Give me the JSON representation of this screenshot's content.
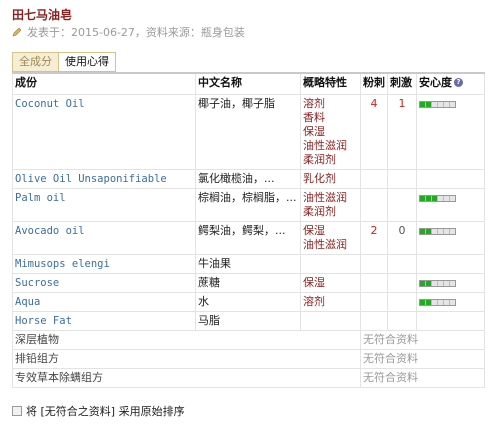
{
  "page": {
    "title": "田七马油皂",
    "meta": "发表于：2015-06-27，资料来源：瓶身包装"
  },
  "tabs": [
    {
      "label": "全成分"
    },
    {
      "label": "使用心得"
    }
  ],
  "table": {
    "headers": {
      "ingredient": "成份",
      "chinese": "中文名称",
      "function": "概略特性",
      "acne": "粉刺",
      "irritation": "刺激",
      "safety": "安心度"
    },
    "rows": [
      {
        "ingredient": "Coconut Oil",
        "chinese": "椰子油，椰子脂",
        "functions": [
          "溶剂",
          "香料",
          "保湿",
          "油性滋润",
          "柔润剂"
        ],
        "acne": "4",
        "irritation": "1",
        "safety": 2
      },
      {
        "ingredient": "Olive Oil Unsaponifiable",
        "chinese": "氯化橄榄油，...",
        "functions": [
          "乳化剂"
        ],
        "acne": "",
        "irritation": "",
        "safety": null
      },
      {
        "ingredient": "Palm oil",
        "chinese": "棕榈油，棕榈脂，...",
        "functions": [
          "油性滋润",
          "柔润剂"
        ],
        "acne": "",
        "irritation": "",
        "safety": 3
      },
      {
        "ingredient": "Avocado oil",
        "chinese": "鳄梨油，鳄梨，...",
        "functions": [
          "保湿",
          "油性滋润"
        ],
        "acne": "2",
        "irritation": "0",
        "safety": 2
      },
      {
        "ingredient": "Mimusops elengi",
        "chinese": "牛油果",
        "functions": [],
        "acne": "",
        "irritation": "",
        "safety": null
      },
      {
        "ingredient": "Sucrose",
        "chinese": "蔗糖",
        "functions": [
          "保湿"
        ],
        "acne": "",
        "irritation": "",
        "safety": 2
      },
      {
        "ingredient": "Aqua",
        "chinese": "水",
        "functions": [
          "溶剂"
        ],
        "acne": "",
        "irritation": "",
        "safety": 2
      },
      {
        "ingredient": "Horse Fat",
        "chinese": "马脂",
        "functions": [],
        "acne": "",
        "irritation": "",
        "safety": null
      }
    ],
    "groups": [
      {
        "label": "深层植物",
        "status": "无符合资料"
      },
      {
        "label": "排铅组方",
        "status": "无符合资料"
      },
      {
        "label": "专效草本除螨组方",
        "status": "无符合资料"
      }
    ]
  },
  "footer": {
    "checkbox_label": "将 [无符合之资料] 采用原始排序"
  },
  "colors": {
    "title": "#8a1e1e",
    "ingredient_link": "#3a6ea5",
    "safety_on": "#22aa22",
    "acne_value": "#cc2222"
  },
  "icons": {
    "meta": "pen-icon",
    "help": "question-icon"
  }
}
